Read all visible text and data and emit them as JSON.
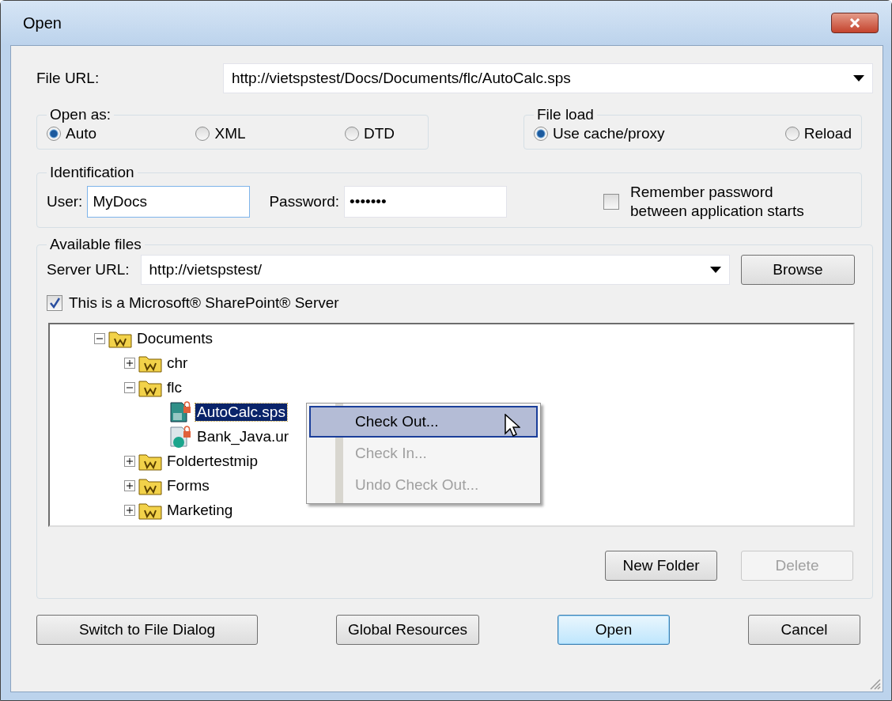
{
  "window": {
    "title": "Open"
  },
  "file_url": {
    "label": "File URL:",
    "value": "http://vietspstest/Docs/Documents/flc/AutoCalc.sps"
  },
  "open_as": {
    "title": "Open as:",
    "options": [
      {
        "label": "Auto",
        "selected": true
      },
      {
        "label": "XML",
        "selected": false
      },
      {
        "label": "DTD",
        "selected": false
      }
    ]
  },
  "file_load": {
    "title": "File load",
    "options": [
      {
        "label": "Use cache/proxy",
        "selected": true
      },
      {
        "label": "Reload",
        "selected": false
      }
    ]
  },
  "identification": {
    "title": "Identification",
    "user_label": "User:",
    "user": "MyDocs",
    "password_label": "Password:",
    "password": "•••••••",
    "remember": {
      "label": "Remember password between application starts",
      "checked": false
    }
  },
  "available_files": {
    "title": "Available files",
    "server_label": "Server URL:",
    "server_url": "http://vietspstest/",
    "browse": {
      "label": "Browse",
      "disabled": false,
      "default": false
    },
    "sharepoint": {
      "label": "This is a Microsoft® SharePoint® Server",
      "checked": true
    },
    "tree": [
      {
        "label": "Documents",
        "kind": "folder",
        "expanded": true,
        "selected": false,
        "children": [
          {
            "label": "chr",
            "kind": "folder",
            "expanded": false,
            "selected": false
          },
          {
            "label": "flc",
            "kind": "folder",
            "expanded": true,
            "selected": false,
            "children": [
              {
                "label": "AutoCalc.sps",
                "kind": "sps-file",
                "selected": true
              },
              {
                "label": "Bank_Java.ur",
                "kind": "java-file",
                "selected": false
              }
            ]
          },
          {
            "label": "Foldertestmip",
            "kind": "folder",
            "expanded": false,
            "selected": false
          },
          {
            "label": "Forms",
            "kind": "folder",
            "expanded": false,
            "selected": false
          },
          {
            "label": "Marketing",
            "kind": "folder",
            "expanded": false,
            "selected": false
          }
        ]
      }
    ],
    "context_menu": [
      {
        "label": "Check Out...",
        "selected": true,
        "disabled": false
      },
      {
        "label": "Check In...",
        "selected": false,
        "disabled": true
      },
      {
        "label": "Undo Check Out...",
        "selected": false,
        "disabled": true
      }
    ],
    "buttons": [
      {
        "label": "New Folder",
        "disabled": false,
        "default": false
      },
      {
        "label": "Delete",
        "disabled": true,
        "default": false
      }
    ]
  },
  "footer_buttons": [
    {
      "label": "Switch to File Dialog",
      "disabled": false,
      "default": false
    },
    {
      "label": "Global Resources",
      "disabled": false,
      "default": false
    },
    {
      "label": "Open",
      "disabled": false,
      "default": true
    },
    {
      "label": "Cancel",
      "disabled": false,
      "default": false
    }
  ]
}
